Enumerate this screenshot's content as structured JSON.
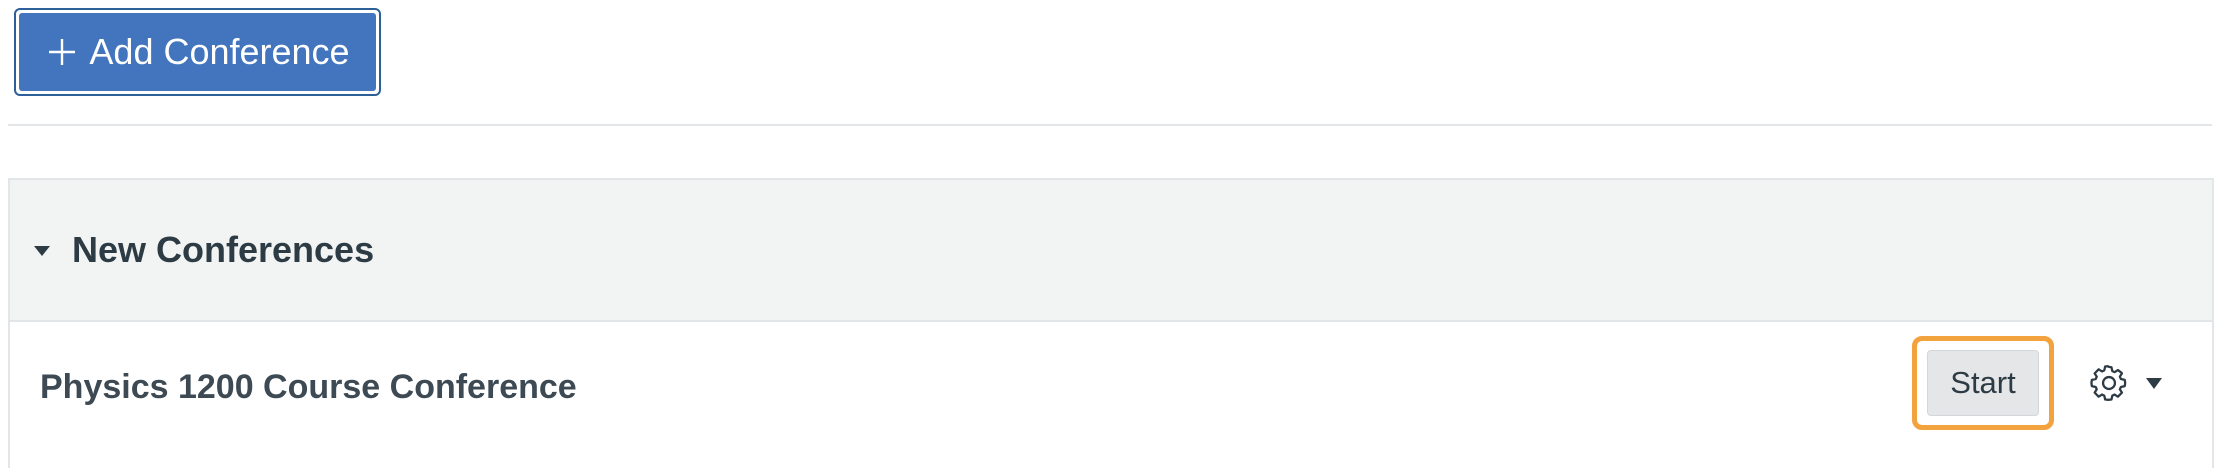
{
  "toolbar": {
    "add_button_label": "Add Conference",
    "add_button_icon": "plus-icon"
  },
  "conferences_section": {
    "title": "New Conferences",
    "toggle_icon": "caret-down-icon",
    "items": [
      {
        "name": "Physics 1200 Course Conference",
        "start_label": "Start",
        "settings_icon": "gear-icon",
        "menu_icon": "caret-down-icon"
      }
    ]
  },
  "colors": {
    "primary_button": "#4275bd",
    "highlight": "#f3a33e",
    "header_bg": "#f2f3f3",
    "text": "#2d3b45"
  }
}
